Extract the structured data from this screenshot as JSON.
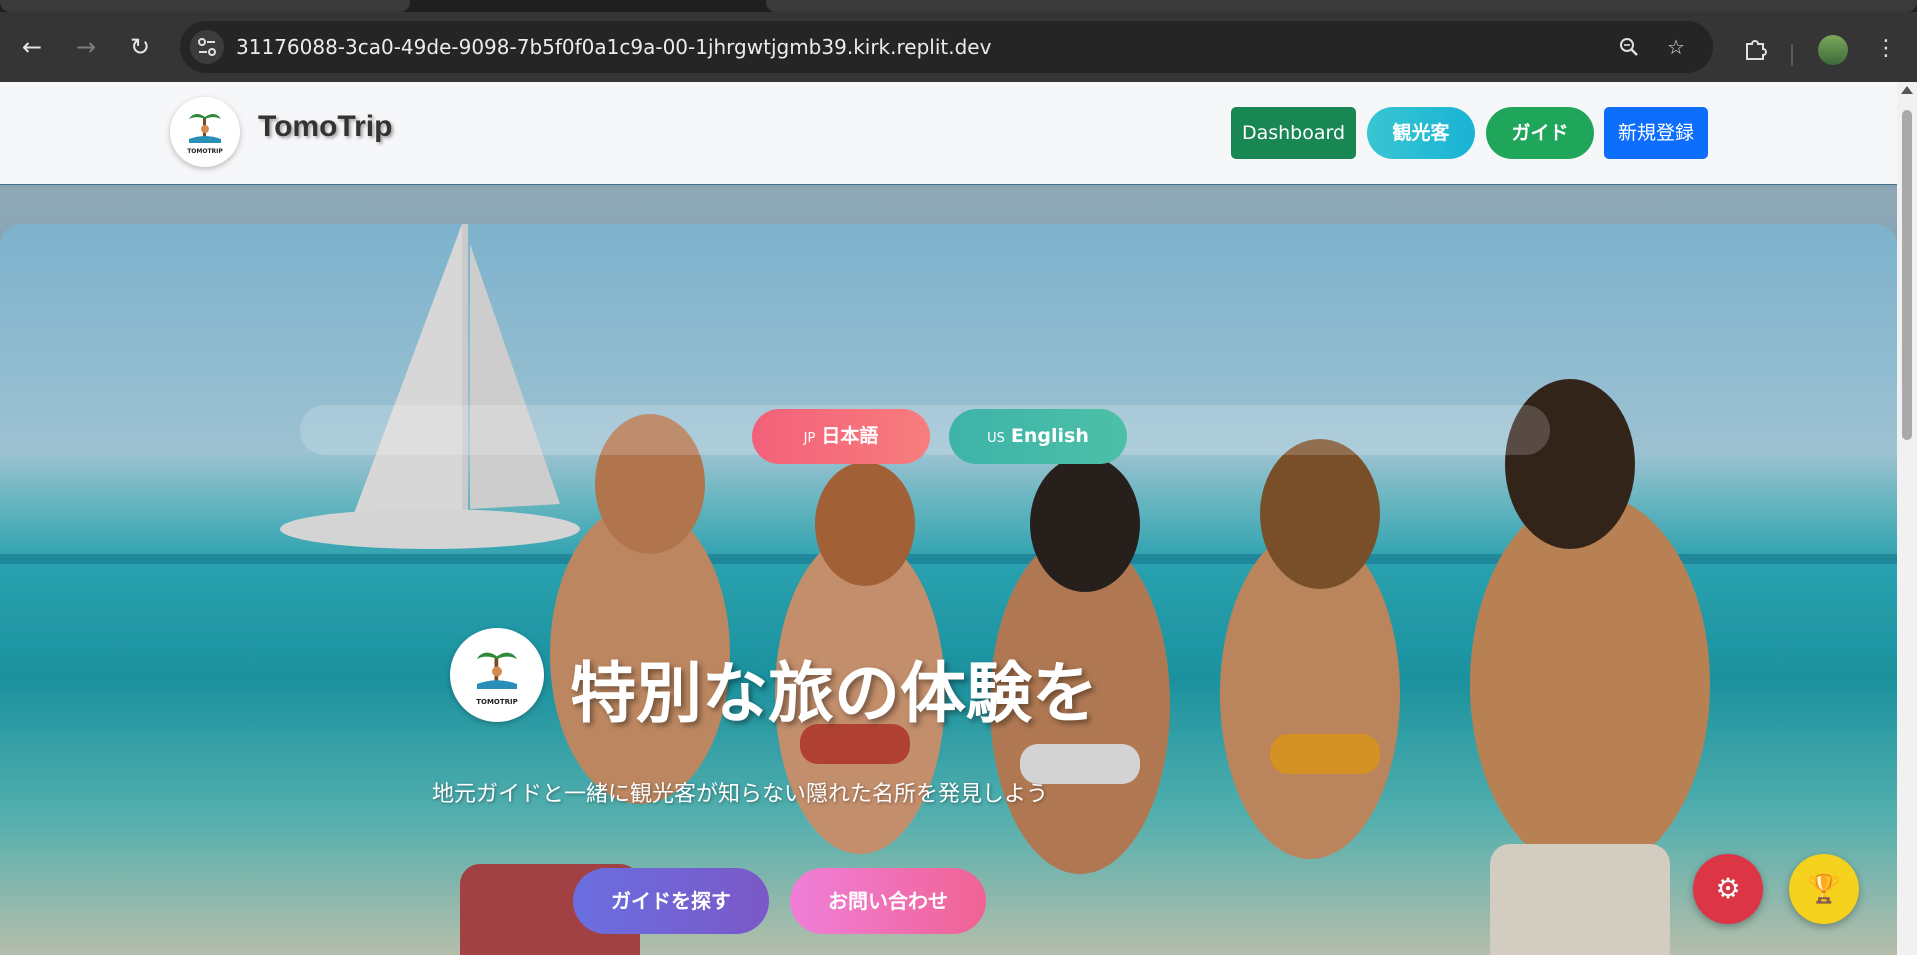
{
  "browser": {
    "url": "31176088-3ca0-49de-9098-7b5f0f0a1c9a-00-1jhrgwtjgmb39.kirk.replit.dev",
    "icons": {
      "back": "back-arrow-icon",
      "forward": "forward-arrow-icon",
      "reload": "reload-icon",
      "site_info": "tune-icon",
      "zoom": "zoom-icon",
      "bookmark": "star-icon",
      "extensions": "puzzle-icon",
      "menu": "kebab-menu-icon"
    }
  },
  "header": {
    "brand": "TomoTrip",
    "logo_text": "TOMOTRIP",
    "buttons": {
      "dashboard": "Dashboard",
      "tourist": "観光客",
      "guide": "ガイド",
      "register": "新規登録"
    },
    "colors": {
      "dashboard": "#198754",
      "tourist": "#1ab3d6",
      "guide": "#1fa65a",
      "register": "#0d6efd"
    }
  },
  "language": {
    "jp_code": "JP",
    "jp_label": "日本語",
    "en_code": "US",
    "en_label": "English"
  },
  "hero": {
    "title": "特別な旅の体験を",
    "subtitle": "地元ガイドと一緒に観光客が知らない隠れた名所を発見しよう",
    "cta_guide": "ガイドを探す",
    "cta_contact": "お問い合わせ"
  },
  "floating": {
    "settings_icon": "gear-icon",
    "trophy_icon": "trophy-icon"
  }
}
